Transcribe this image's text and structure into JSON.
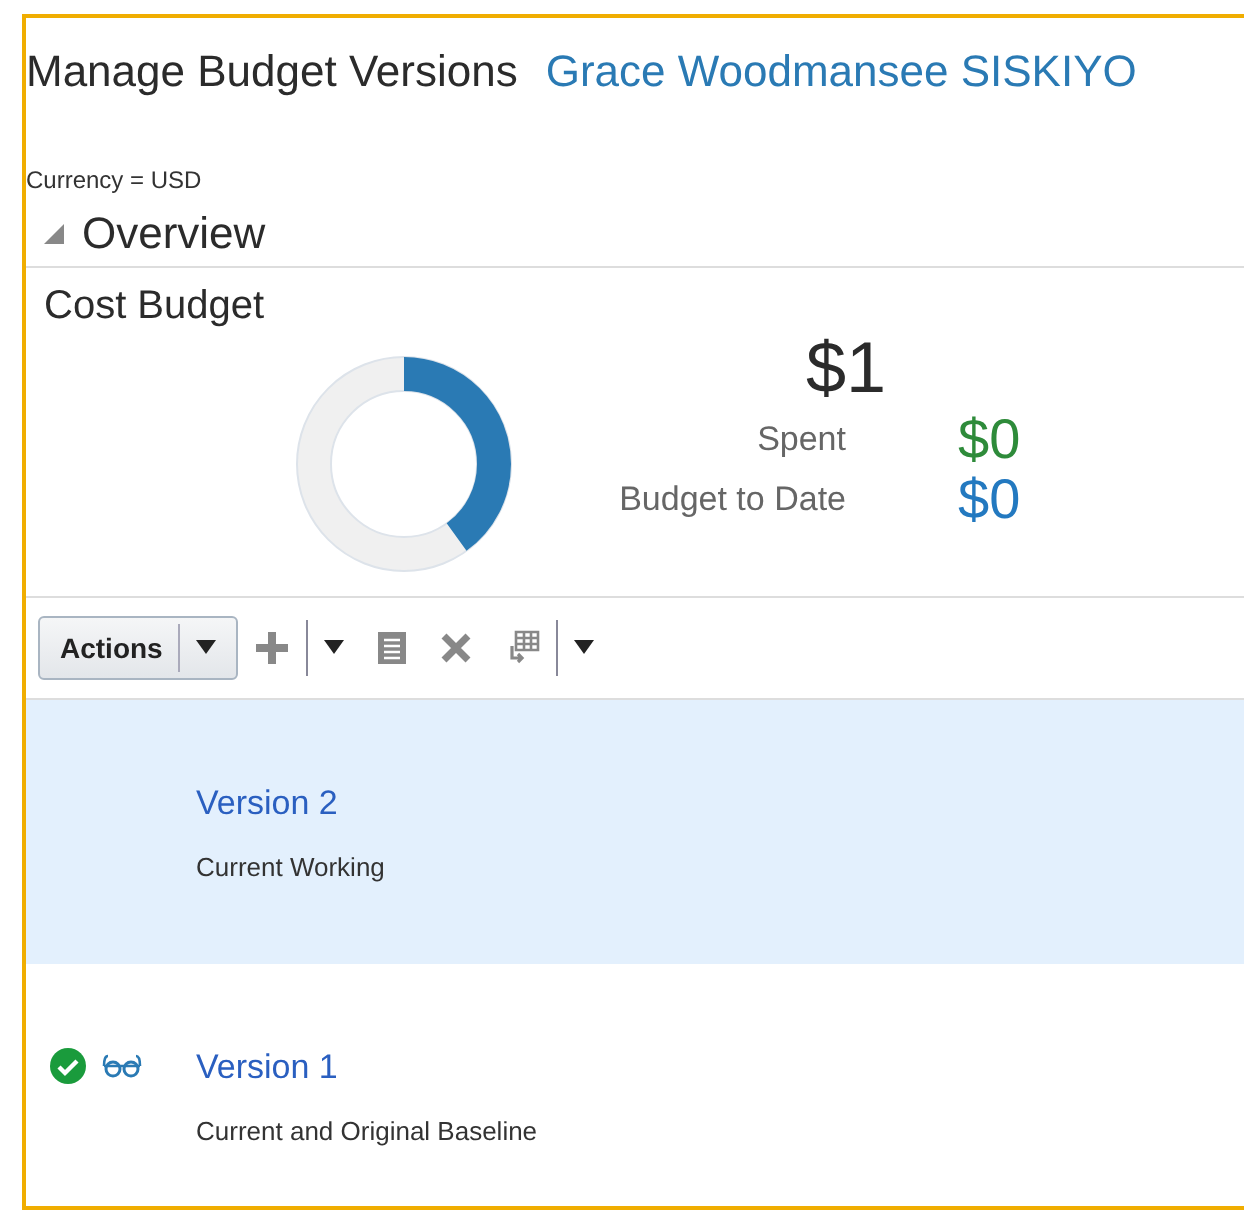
{
  "header": {
    "title": "Manage Budget Versions",
    "project_link": "Grace Woodmansee SISKIYO"
  },
  "currency": "Currency = USD",
  "overview": {
    "title": "Overview",
    "expanded": true
  },
  "cost_budget": {
    "title": "Cost Budget",
    "donut": {
      "level": 0.4
    },
    "total": "$1",
    "metrics": [
      {
        "label": "Spent",
        "value": "$0",
        "color": "#2e8b3a"
      },
      {
        "label": "Budget to Date",
        "value": "$0",
        "color": "#2379c0"
      }
    ]
  },
  "toolbar": {
    "actions_label": "Actions"
  },
  "versions": [
    {
      "name": "Version 2",
      "description": "Current Working",
      "selected": true,
      "approved": false,
      "baseline": false
    },
    {
      "name": "Version 1",
      "description": "Current and Original Baseline",
      "selected": false,
      "approved": true,
      "baseline": true
    }
  ]
}
